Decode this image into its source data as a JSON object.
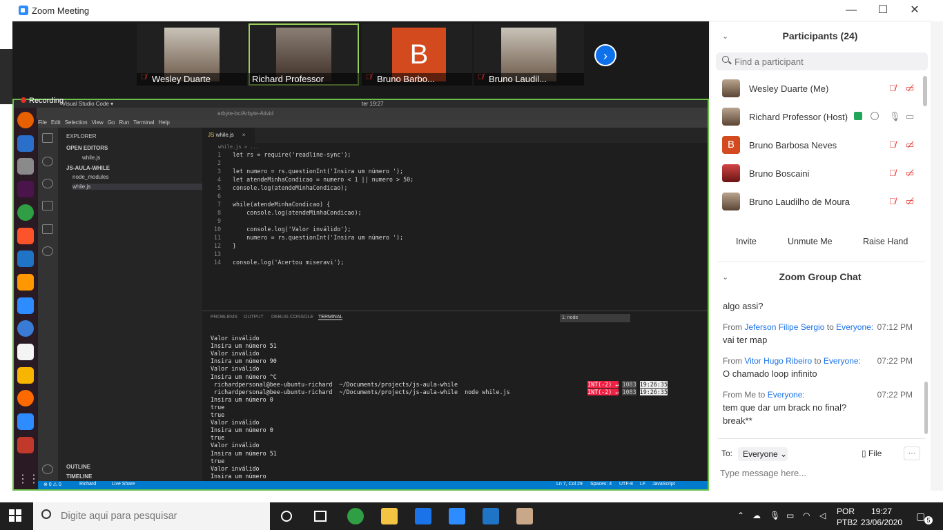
{
  "window": {
    "title": "Zoom Meeting",
    "min": "—",
    "max": "☐",
    "close": "✕"
  },
  "gallery": {
    "tiles": [
      {
        "name": "Wesley Duarte"
      },
      {
        "name": "Richard Professor"
      },
      {
        "name": "Bruno Barbo...",
        "initial": "B"
      },
      {
        "name": "Bruno Laudil..."
      }
    ],
    "next": "›",
    "recording": "Recording"
  },
  "ubuntu": {
    "app": "Visual Studio Code ▾",
    "clock": "ter 19:27",
    "tab": "arbyte-bc/Arbyte-Ativid"
  },
  "vscode": {
    "menu": [
      "File",
      "Edit",
      "Selection",
      "View",
      "Go",
      "Run",
      "Terminal",
      "Help"
    ],
    "explorer": {
      "title": "EXPLORER",
      "open_editors": "OPEN EDITORS",
      "open_file": "while.js",
      "project": "JS-AULA-WHILE",
      "folder": "node_modules",
      "file": "while.js",
      "outline": "OUTLINE",
      "timeline": "TIMELINE"
    },
    "tab": {
      "label": "while.js",
      "breadcrumb": "while.js > ..."
    },
    "code": [
      {
        "n": "1",
        "t": "let rs = require('readline-sync');"
      },
      {
        "n": "2",
        "t": ""
      },
      {
        "n": "3",
        "t": "let numero = rs.questionInt('Insira um número ');"
      },
      {
        "n": "4",
        "t": "let atendeMinhaCondicao = numero < 1 || numero > 50;"
      },
      {
        "n": "5",
        "t": "console.log(atendeMinhaCondicao);"
      },
      {
        "n": "6",
        "t": ""
      },
      {
        "n": "7",
        "t": "while(atendeMinhaCondicao) {"
      },
      {
        "n": "8",
        "t": "    console.log(atendeMinhaCondicao);"
      },
      {
        "n": "9",
        "t": ""
      },
      {
        "n": "10",
        "t": "    console.log('Valor inválido');"
      },
      {
        "n": "11",
        "t": "    numero = rs.questionInt('Insira um número ');"
      },
      {
        "n": "12",
        "t": "}"
      },
      {
        "n": "13",
        "t": ""
      },
      {
        "n": "14",
        "t": "console.log('Acertou miseravi');"
      }
    ],
    "panel_tabs": [
      "PROBLEMS",
      "OUTPUT",
      "DEBUG CONSOLE",
      "TERMINAL"
    ],
    "terminal_select": "1: node",
    "terminal": [
      "Valor inválido",
      "Insira um número 51",
      "Valor inválido",
      "Insira um número 90",
      "Valor inválido",
      "Insira um número ^C",
      " richardpersonal@bee-ubuntu-richard  ~/Documents/projects/js-aula-while ",
      " richardpersonal@bee-ubuntu-richard  ~/Documents/projects/js-aula-while  node while.js",
      "Insira um número 0",
      "true",
      "true",
      "Valor inválido",
      "Insira um número 0",
      "true",
      "Valor inválido",
      "Insira um número 51",
      "true",
      "Valor inválido",
      "Insira um número "
    ],
    "prompt_right": {
      "code": "INT(-2) ↵",
      "num": "1083",
      "time": "19:26:35"
    },
    "status": {
      "errors": "⊗ 0 ⚠ 0",
      "user": "Richard",
      "share": "Live Share",
      "pos": "Ln 7, Col 29",
      "spaces": "Spaces: 4",
      "enc": "UTF-8",
      "eol": "LF",
      "lang": "JavaScript"
    }
  },
  "participants": {
    "title": "Participants (24)",
    "search_placeholder": "Find a participant",
    "list": [
      {
        "name": "Wesley Duarte (Me)"
      },
      {
        "name": "Richard Professor (Host)"
      },
      {
        "name": "Bruno Barbosa Neves",
        "initial": "B"
      },
      {
        "name": "Bruno Boscaini"
      },
      {
        "name": "Bruno Laudilho de Moura"
      }
    ],
    "invite": "Invite",
    "unmute": "Unmute Me",
    "raise": "Raise Hand"
  },
  "chat": {
    "title": "Zoom Group Chat",
    "partial": "algo assi?",
    "messages": [
      {
        "prefix": "From",
        "from": "Jeferson Filipe Sergio",
        "to_word": "to",
        "to": "Everyone:",
        "time": "07:12 PM",
        "text": "vai ter map"
      },
      {
        "prefix": "From",
        "from": "Vitor Hugo Ribeiro",
        "to_word": "to",
        "to": "Everyone:",
        "time": "07:22 PM",
        "text": "O chamado loop infinito"
      },
      {
        "prefix": "From Me",
        "from": "",
        "to_word": "to",
        "to": "Everyone:",
        "time": "07:22 PM",
        "text": "tem que dar um brack no final?",
        "text2": "break**"
      }
    ],
    "to_label": "To:",
    "to_value": "Everyone",
    "file": "File",
    "more": "···",
    "input_placeholder": "Type message here..."
  },
  "taskbar": {
    "search_placeholder": "Digite aqui para pesquisar",
    "lang1": "POR",
    "lang2": "PTB2",
    "time": "19:27",
    "date": "23/06/2020",
    "notif": "5"
  }
}
